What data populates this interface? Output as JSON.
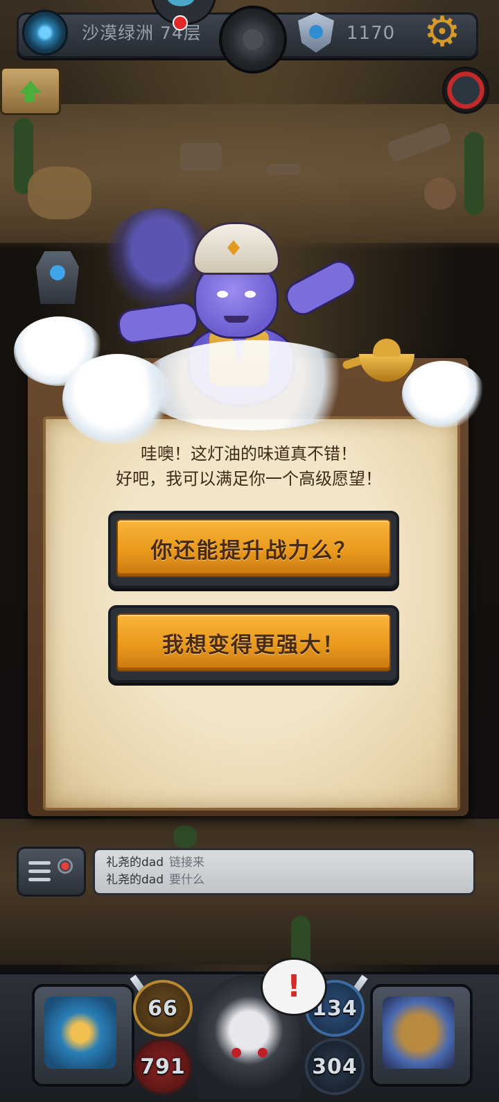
{
  "header": {
    "floor_label": "沙漠绿洲 74层",
    "coin_value": "1170"
  },
  "dialog": {
    "line1": "哇噢！这灯油的味道真不错！",
    "line2": "好吧，我可以满足你一个高级愿望！",
    "choices": [
      {
        "label": "你还能提升战力么？"
      },
      {
        "label": "我想变得更强大！"
      }
    ]
  },
  "chat": {
    "messages": [
      {
        "user": "礼尧的dad",
        "text": "链接来"
      },
      {
        "user": "礼尧的dad",
        "text": "要什么"
      }
    ]
  },
  "bottom": {
    "stats": {
      "attack": "66",
      "health": "791",
      "defense": "134",
      "speed": "304"
    },
    "alert": "!"
  },
  "colors": {
    "button_orange": "#e99a1c",
    "panel_parchment": "#f2e6c8",
    "panel_frame": "#6a4a2e",
    "gear_gold": "#d49a2a",
    "alert_red": "#d42a2a"
  },
  "icons": [
    "portal-icon",
    "shield-icon",
    "gear-icon",
    "up-arrow-icon",
    "monster-icon",
    "chat-radio-icon",
    "compass-icon",
    "inventory-icon",
    "alert-icon"
  ]
}
